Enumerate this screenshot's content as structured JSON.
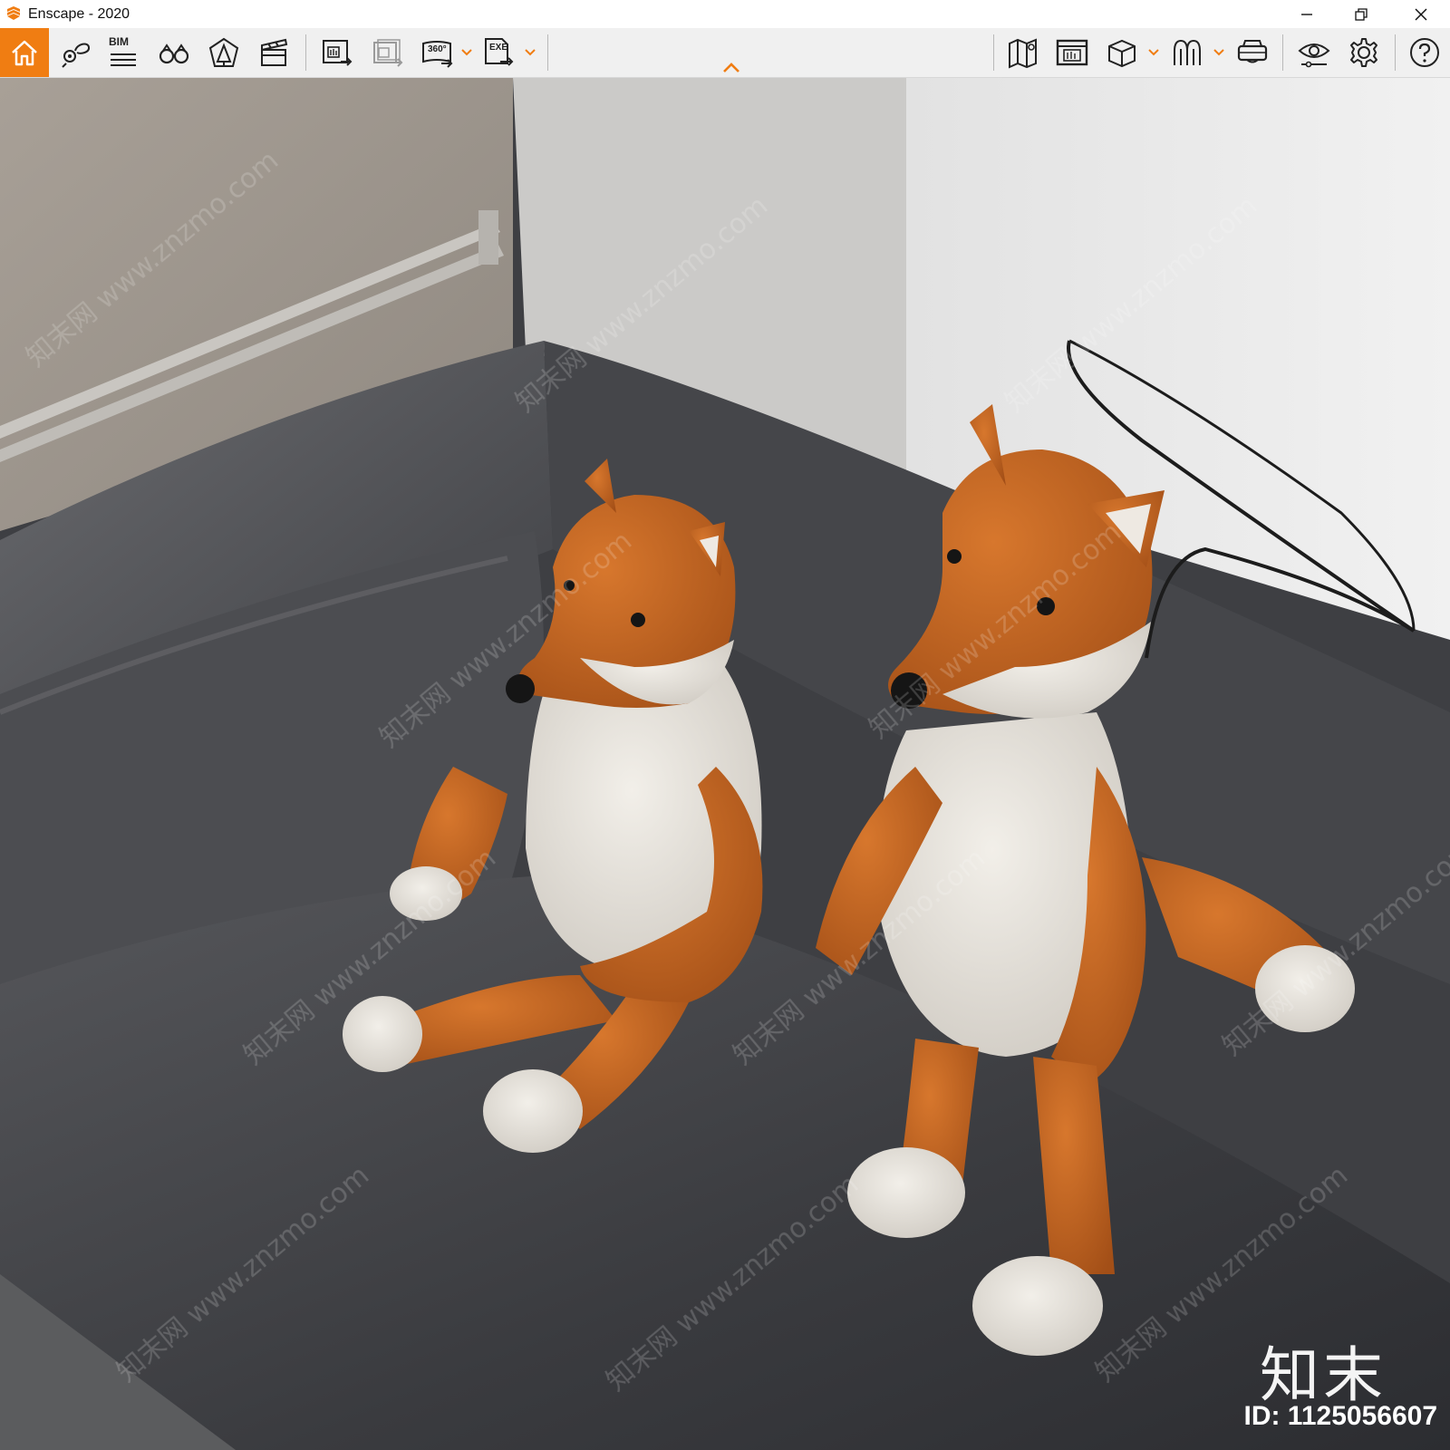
{
  "window": {
    "title": "Enscape - 2020",
    "controls": [
      "minimize",
      "restore",
      "close"
    ]
  },
  "toolbar": {
    "accent_color": "#f07d12",
    "home": "home-icon",
    "left_group": [
      {
        "name": "bookmarks",
        "icon": "views-pin-icon"
      },
      {
        "name": "bim",
        "icon": "bim-icon",
        "label": "BIM"
      },
      {
        "name": "binoculars",
        "icon": "binoculars-icon"
      },
      {
        "name": "navigation",
        "icon": "bell-tent-icon"
      },
      {
        "name": "video-editor",
        "icon": "clapperboard-icon"
      },
      {
        "name": "render-image",
        "icon": "render-export-icon"
      },
      {
        "name": "batch-render",
        "icon": "batch-render-icon"
      },
      {
        "name": "panorama",
        "icon": "panorama-360-icon",
        "label": "360°",
        "has_dropdown": true
      },
      {
        "name": "standalone",
        "icon": "exe-export-icon",
        "label": "EXE",
        "has_dropdown": true
      }
    ],
    "right_group": [
      {
        "name": "map",
        "icon": "map-icon"
      },
      {
        "name": "render-preview",
        "icon": "monitor-icon"
      },
      {
        "name": "asset-box",
        "icon": "box-icon",
        "has_dropdown": true
      },
      {
        "name": "asset-library",
        "icon": "trees-icon",
        "has_dropdown": true
      },
      {
        "name": "vr-headset",
        "icon": "vr-headset-icon"
      },
      {
        "name": "visual-settings",
        "icon": "eye-settings-icon"
      },
      {
        "name": "general-settings",
        "icon": "gear-icon"
      },
      {
        "name": "help",
        "icon": "help-icon"
      }
    ],
    "collapse": "chevron-up-icon"
  },
  "viewport": {
    "watermark_brand": "知末",
    "watermark_text": "知末网 www.znzmo.com",
    "image_id": "ID: 1125056607"
  }
}
